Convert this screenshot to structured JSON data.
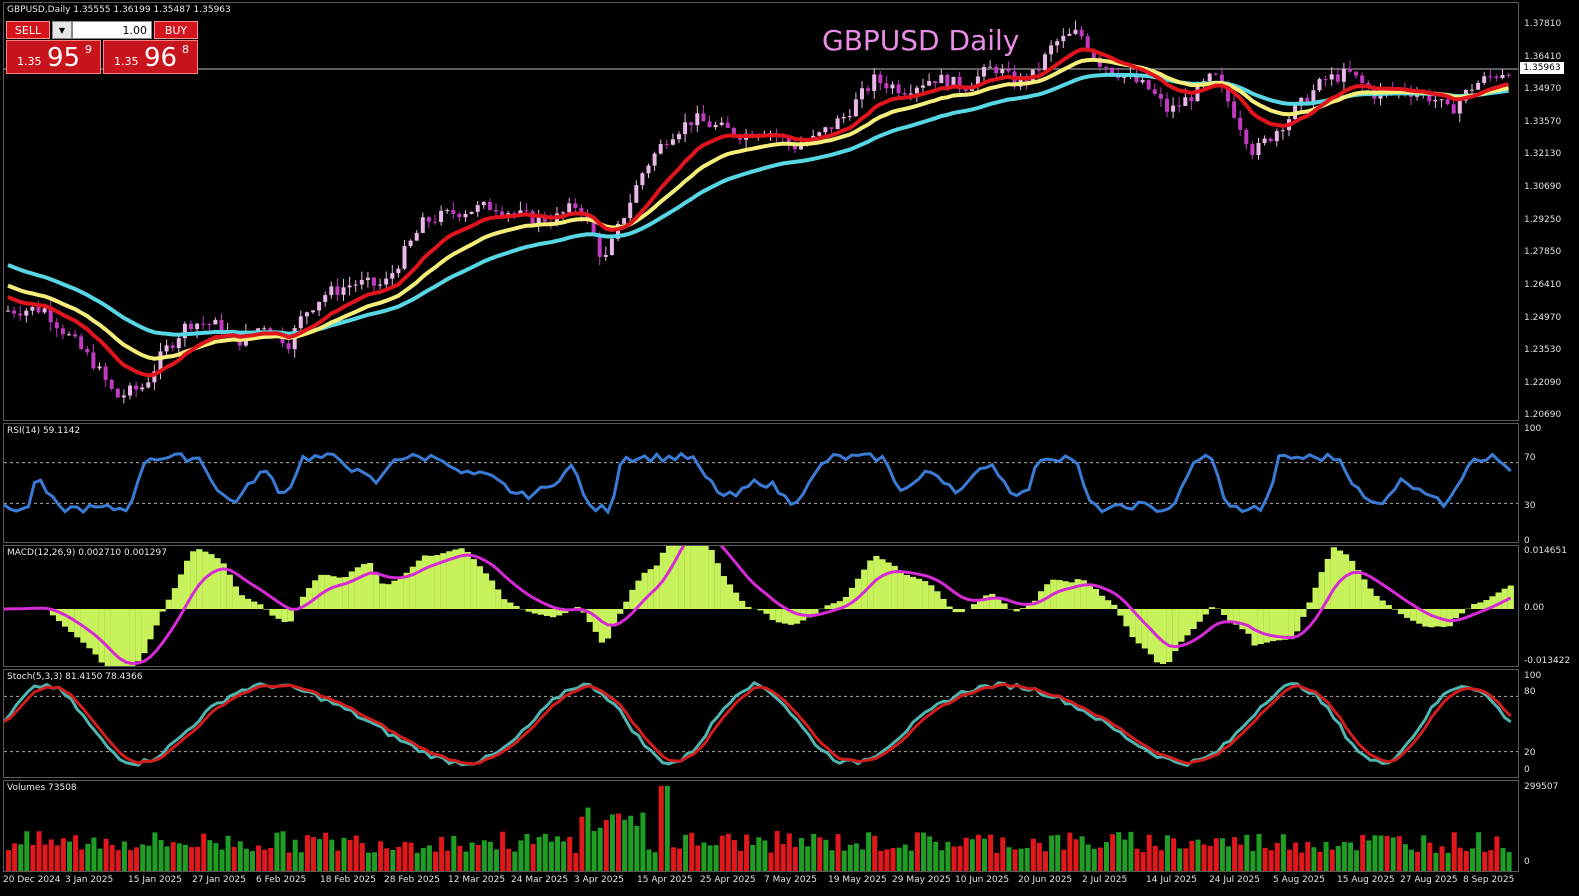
{
  "main": {
    "header": "GBPUSD,Daily  1.35555 1.36199 1.35487 1.35963",
    "title": "GBPUSD Daily",
    "current_price_tag": "1.35963",
    "price_axis": [
      "1.37810",
      "1.36410",
      "1.34970",
      "1.33570",
      "1.32130",
      "1.30690",
      "1.29250",
      "1.27850",
      "1.26410",
      "1.24970",
      "1.23530",
      "1.22090",
      "1.20690"
    ]
  },
  "trade_panel": {
    "sell_label": "SELL",
    "buy_label": "BUY",
    "lot_value": "1.00",
    "sell_small": "1.35",
    "sell_big": "95",
    "sell_sup": "9",
    "buy_small": "1.35",
    "buy_big": "96",
    "buy_sup": "8"
  },
  "rsi": {
    "label": "RSI(14) 59.1142",
    "axis": [
      "100",
      "70",
      "30",
      "0"
    ]
  },
  "macd": {
    "label": "MACD(12,26,9) 0.002710 0.001297",
    "axis": [
      "0.014651",
      "0.00",
      "-0.013422"
    ]
  },
  "stoch": {
    "label": "Stoch(5,3,3) 81.4150 78.4366",
    "axis": [
      "100",
      "80",
      "20",
      "0"
    ]
  },
  "volumes": {
    "label": "Volumes 73508",
    "axis": [
      "299507",
      "0"
    ]
  },
  "dates": [
    "20 Dec 2024",
    "3 Jan 2025",
    "15 Jan 2025",
    "27 Jan 2025",
    "6 Feb 2025",
    "18 Feb 2025",
    "28 Feb 2025",
    "12 Mar 2025",
    "24 Mar 2025",
    "3 Apr 2025",
    "15 Apr 2025",
    "25 Apr 2025",
    "7 May 2025",
    "19 May 2025",
    "29 May 2025",
    "10 Jun 2025",
    "20 Jun 2025",
    "2 Jul 2025",
    "14 Jul 2025",
    "24 Jul 2025",
    "5 Aug 2025",
    "15 Aug 2025",
    "27 Aug 2025",
    "8 Sep 2025"
  ],
  "colors": {
    "bull": "#e9b7e8",
    "bear": "#c03bbf",
    "ma_fast": "#e0141c",
    "ma_mid": "#f5ef7a",
    "ma_slow": "#57d6e4",
    "rsi_line": "#3a7bd5",
    "macd_hist": "#c7f25b",
    "macd_signal": "#d62ad6",
    "stoch_main": "#4fb5b0",
    "stoch_signal": "#d21d1d",
    "vol_up": "#1f9d25",
    "vol_down": "#e0181c"
  }
}
